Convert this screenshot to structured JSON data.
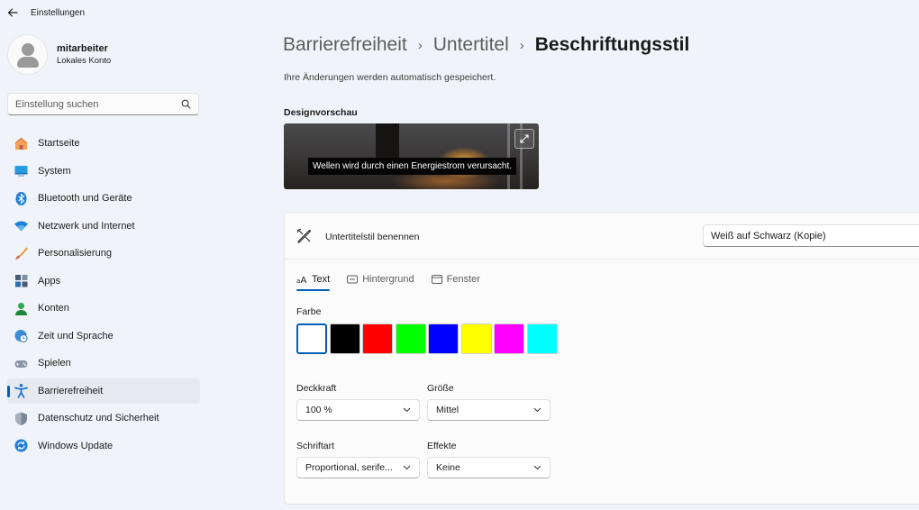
{
  "app": {
    "title": "Einstellungen"
  },
  "profile": {
    "name": "mitarbeiter",
    "account_type": "Lokales Konto"
  },
  "search": {
    "placeholder": "Einstellung suchen"
  },
  "nav": {
    "items": [
      {
        "label": "Startseite",
        "icon": "home-icon"
      },
      {
        "label": "System",
        "icon": "system-icon"
      },
      {
        "label": "Bluetooth und Geräte",
        "icon": "bluetooth-icon"
      },
      {
        "label": "Netzwerk und Internet",
        "icon": "wifi-icon"
      },
      {
        "label": "Personalisierung",
        "icon": "brush-icon"
      },
      {
        "label": "Apps",
        "icon": "apps-icon"
      },
      {
        "label": "Konten",
        "icon": "account-icon"
      },
      {
        "label": "Zeit und Sprache",
        "icon": "globe-clock-icon"
      },
      {
        "label": "Spielen",
        "icon": "gamepad-icon"
      },
      {
        "label": "Barrierefreiheit",
        "icon": "accessibility-icon"
      },
      {
        "label": "Datenschutz und Sicherheit",
        "icon": "shield-icon"
      },
      {
        "label": "Windows Update",
        "icon": "update-icon"
      }
    ],
    "active": "Barrierefreiheit"
  },
  "breadcrumb": {
    "items": [
      "Barrierefreiheit",
      "Untertitel"
    ],
    "current": "Beschriftungsstil"
  },
  "autosave_note": "Ihre Änderungen werden automatisch gespeichert.",
  "preview": {
    "title": "Designvorschau",
    "caption": "Wellen wird durch einen Energiestrom verursacht."
  },
  "style_name": {
    "label": "Untertitelstil benennen",
    "value": "Weiß auf Schwarz (Kopie)"
  },
  "tabs": [
    {
      "label": "Text",
      "icon": "text-icon",
      "active": true
    },
    {
      "label": "Hintergrund",
      "icon": "background-icon",
      "active": false
    },
    {
      "label": "Fenster",
      "icon": "window-icon",
      "active": false
    }
  ],
  "color": {
    "label": "Farbe",
    "swatches": [
      "#ffffff",
      "#000000",
      "#ff0000",
      "#00ff00",
      "#0000ff",
      "#ffff00",
      "#ff00ff",
      "#00ffff"
    ],
    "selected": "#ffffff"
  },
  "fields": {
    "opacity": {
      "label": "Deckkraft",
      "value": "100 %"
    },
    "size": {
      "label": "Größe",
      "value": "Mittel"
    },
    "font": {
      "label": "Schriftart",
      "value": "Proportional, serife..."
    },
    "effects": {
      "label": "Effekte",
      "value": "Keine"
    }
  },
  "colors": {
    "accent": "#005fb8",
    "background": "#f0f3f9",
    "card": "#fbfbfb"
  }
}
